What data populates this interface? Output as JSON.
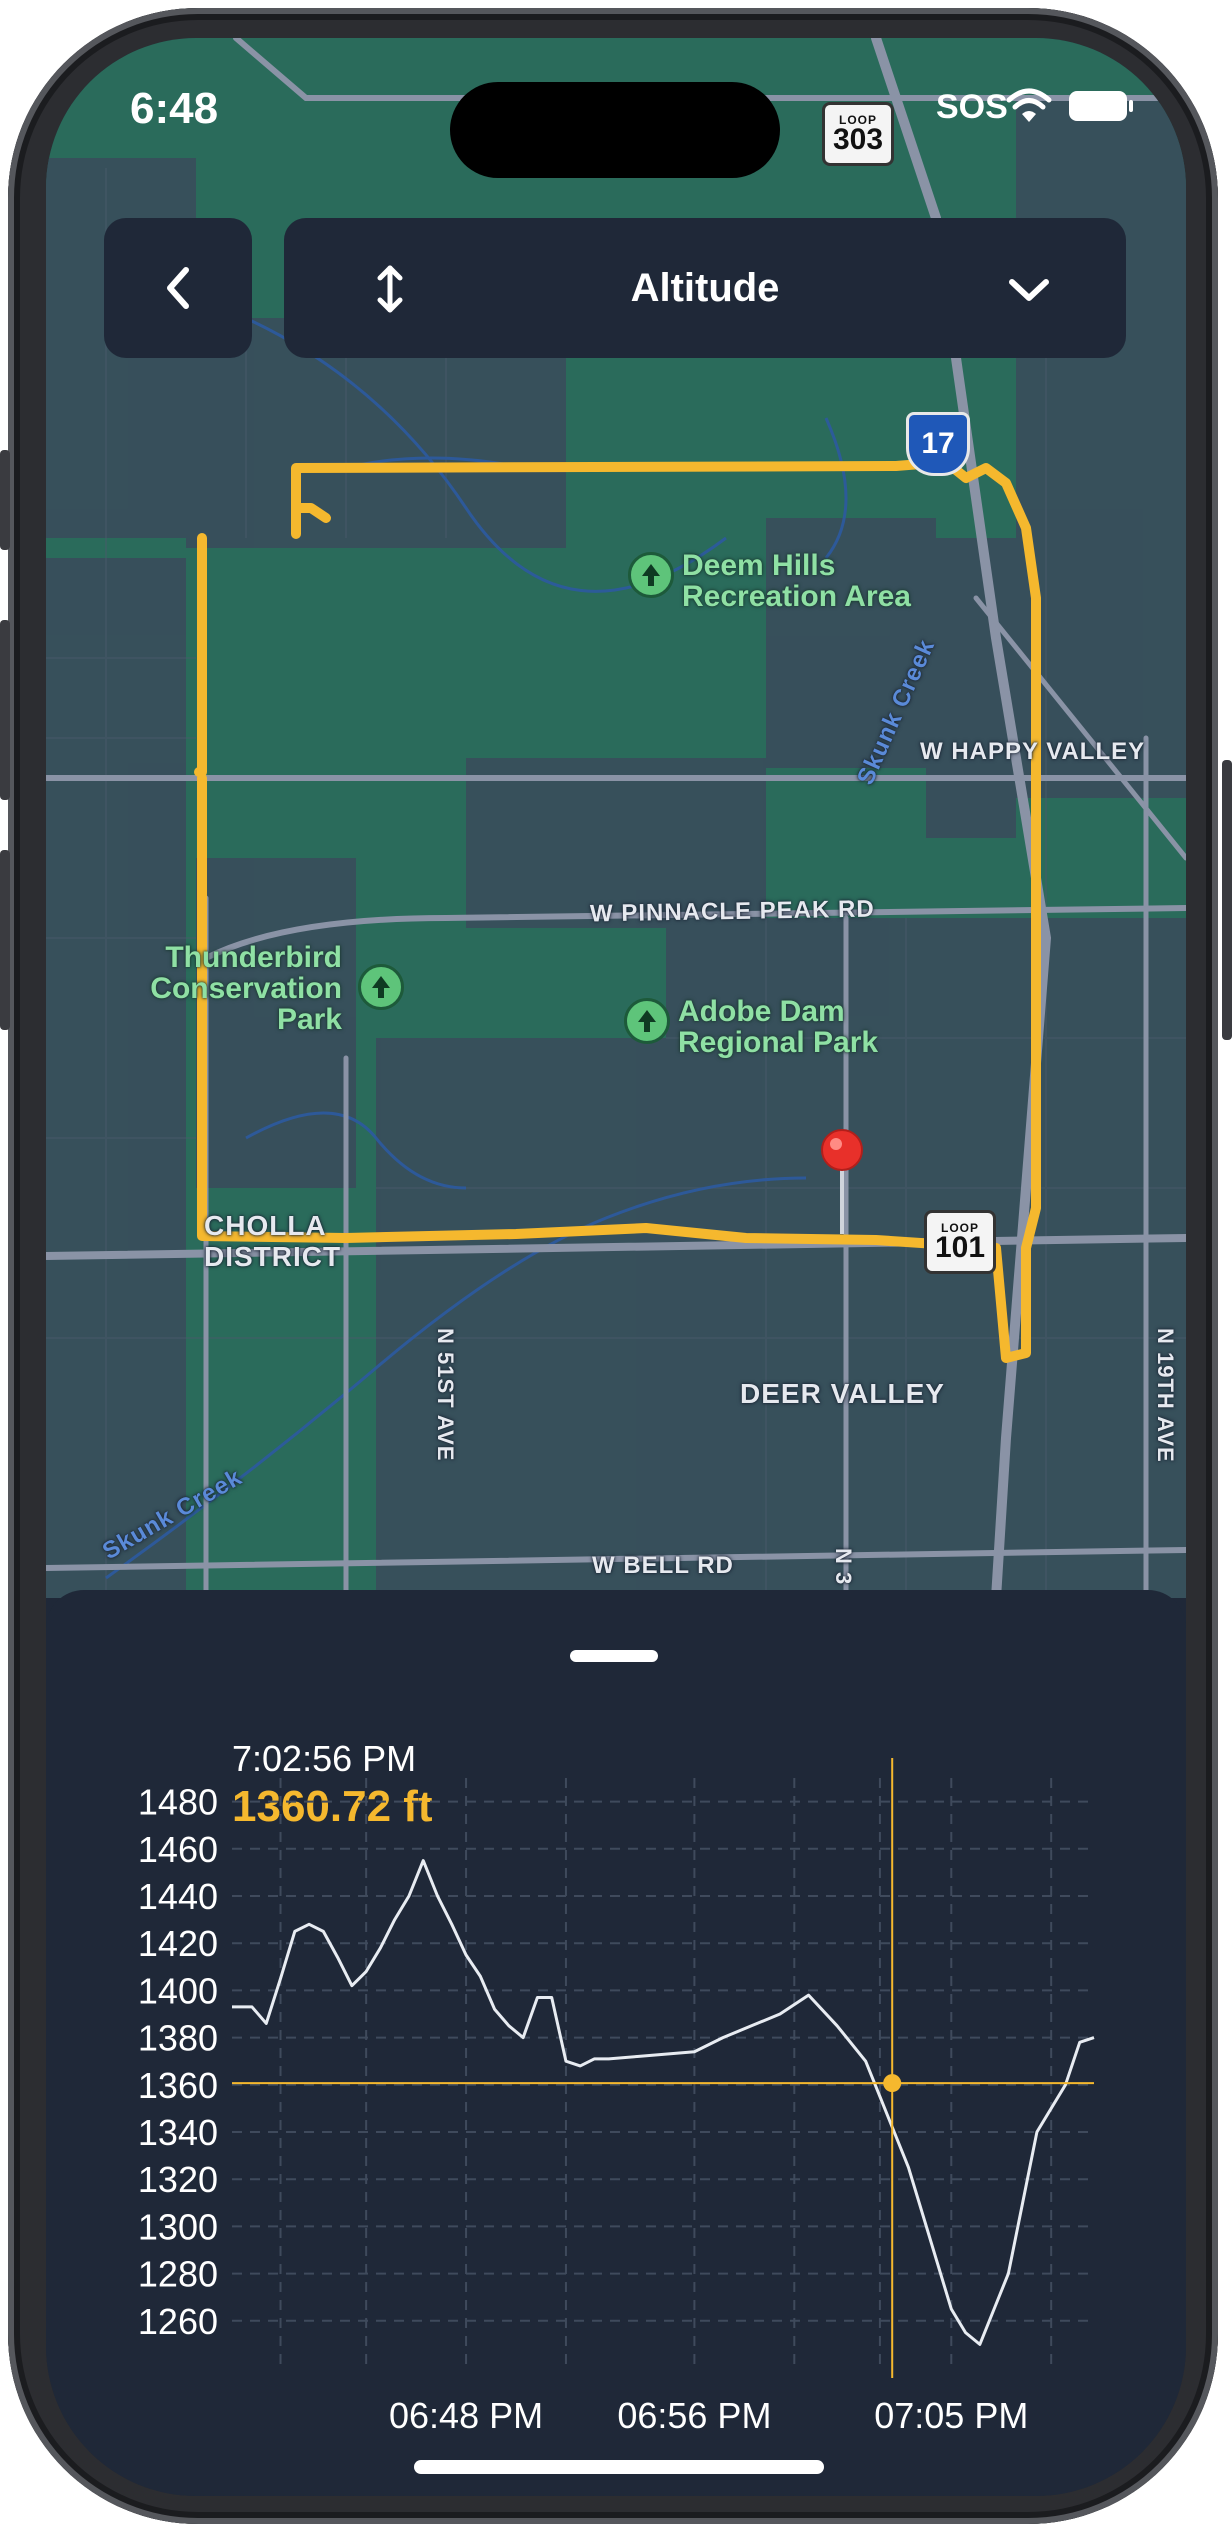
{
  "status_bar": {
    "time": "6:48",
    "sos": "SOS",
    "icons": [
      "cellular-wifi-icon",
      "battery-icon"
    ]
  },
  "controls": {
    "back_icon": "chevron-left-icon",
    "sort_icon": "up-down-arrows-icon",
    "metric": "Altitude",
    "dropdown_icon": "chevron-down-icon"
  },
  "map": {
    "shields": [
      {
        "top": "LOOP",
        "num": "303"
      },
      {
        "top": "LOOP",
        "num": "101"
      },
      {
        "top": "",
        "num": "17"
      }
    ],
    "places": [
      {
        "name": "Deem Hills\nRecreation Area"
      },
      {
        "name": "Thunderbird\nConservation\nPark"
      },
      {
        "name": "Adobe Dam\nRegional Park"
      }
    ],
    "roads": [
      "W HAPPY VALLEY",
      "W PINNACLE PEAK RD",
      "W BELL RD",
      "N 51ST AVE",
      "N 19TH AVE",
      "N 3"
    ],
    "areas": [
      "CHOLLA\nDISTRICT",
      "DEER VALLEY"
    ],
    "waterways": [
      "Skunk Creek",
      "Skunk Creek"
    ],
    "colors": {
      "route": "#f5b82e",
      "pin": "#e8302a",
      "park": "#2a6b5b"
    }
  },
  "chart": {
    "readout_time": "7:02:56 PM",
    "readout_value": "1360.72 ft",
    "accent": "#f5b82e"
  },
  "chart_data": {
    "type": "line",
    "title": "",
    "xlabel": "",
    "ylabel": "",
    "ylim": [
      1240,
      1490
    ],
    "y_ticks": [
      1480,
      1460,
      1440,
      1420,
      1400,
      1380,
      1360,
      1340,
      1320,
      1300,
      1280,
      1260
    ],
    "x_ticks": [
      "06:48 PM",
      "06:56 PM",
      "07:05 PM"
    ],
    "x_minutes_ticks": [
      48,
      56,
      65
    ],
    "crosshair": {
      "time": "7:02:56 PM",
      "value": 1360.72
    },
    "series": [
      {
        "values_time_minutes": [
          39.8,
          40.5,
          41.0,
          41.5,
          42.0,
          42.5,
          43.0,
          43.5,
          44.0,
          44.5,
          45.0,
          45.5,
          46.0,
          46.5,
          47.0,
          47.5,
          48.0,
          48.5,
          49.0,
          49.5,
          50.0,
          50.5,
          51.0,
          51.5,
          52.0,
          52.5,
          53.0,
          54.0,
          55.0,
          56.0,
          57.0,
          58.0,
          59.0,
          60.0,
          61.0,
          62.0,
          62.5,
          63.0,
          63.5,
          64.0,
          64.5,
          65.0,
          65.5,
          66.0,
          66.5,
          67.0,
          67.5,
          68.0,
          68.5,
          69.0,
          69.5,
          70.0
        ],
        "values": [
          1393,
          1393,
          1386,
          1405,
          1425,
          1428,
          1425,
          1414,
          1402,
          1408,
          1418,
          1430,
          1440,
          1455,
          1440,
          1428,
          1415,
          1406,
          1392,
          1385,
          1380,
          1397,
          1397,
          1370,
          1368,
          1371,
          1371,
          1372,
          1373,
          1374,
          1380,
          1385,
          1390,
          1398,
          1385,
          1370,
          1355,
          1340,
          1325,
          1305,
          1285,
          1265,
          1255,
          1250,
          1265,
          1280,
          1310,
          1340,
          1350,
          1360,
          1378,
          1380
        ]
      }
    ]
  }
}
